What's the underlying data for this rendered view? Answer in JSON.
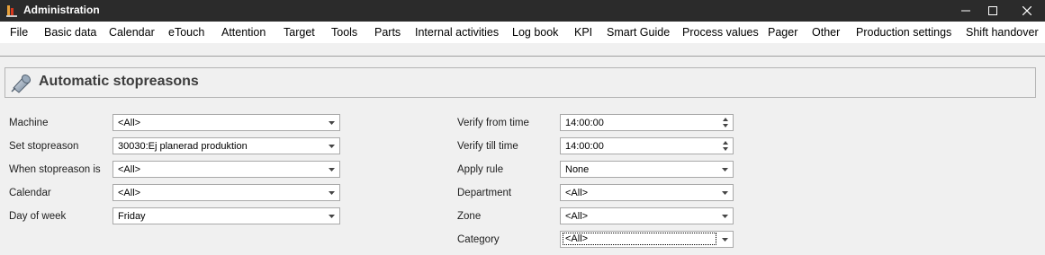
{
  "window": {
    "title": "Administration"
  },
  "menu": [
    "File",
    "Basic data",
    "Calendar",
    "eTouch",
    "Attention",
    "Target",
    "Tools",
    "Parts",
    "Internal activities",
    "Log book",
    "KPI",
    "Smart Guide",
    "Process values",
    "Pager",
    "Other",
    "Production settings",
    "Shift handover"
  ],
  "header": {
    "title": "Automatic stopreasons"
  },
  "left_form": {
    "machine": {
      "label": "Machine",
      "value": "<All>"
    },
    "set_stopreason": {
      "label": "Set stopreason",
      "value": "30030:Ej planerad produktion"
    },
    "when_stopreason": {
      "label": "When stopreason is",
      "value": "<All>"
    },
    "calendar": {
      "label": "Calendar",
      "value": "<All>"
    },
    "day_of_week": {
      "label": "Day of week",
      "value": "Friday"
    }
  },
  "right_form": {
    "verify_from": {
      "label": "Verify from time",
      "value": "14:00:00"
    },
    "verify_till": {
      "label": "Verify till time",
      "value": "14:00:00"
    },
    "apply_rule": {
      "label": "Apply rule",
      "value": "None"
    },
    "department": {
      "label": "Department",
      "value": "<All>"
    },
    "zone": {
      "label": "Zone",
      "value": "<All>"
    },
    "category": {
      "label": "Category",
      "value": "<All>"
    }
  },
  "colors": {
    "titlebar": "#2b2b2b",
    "menubar": "#ffffff",
    "background": "#f0f0f0"
  },
  "icons": [
    "app-icon",
    "minimize-icon",
    "maximize-icon",
    "close-icon",
    "header-pin-icon",
    "chevron-down-icon",
    "spin-up-icon",
    "spin-down-icon"
  ]
}
